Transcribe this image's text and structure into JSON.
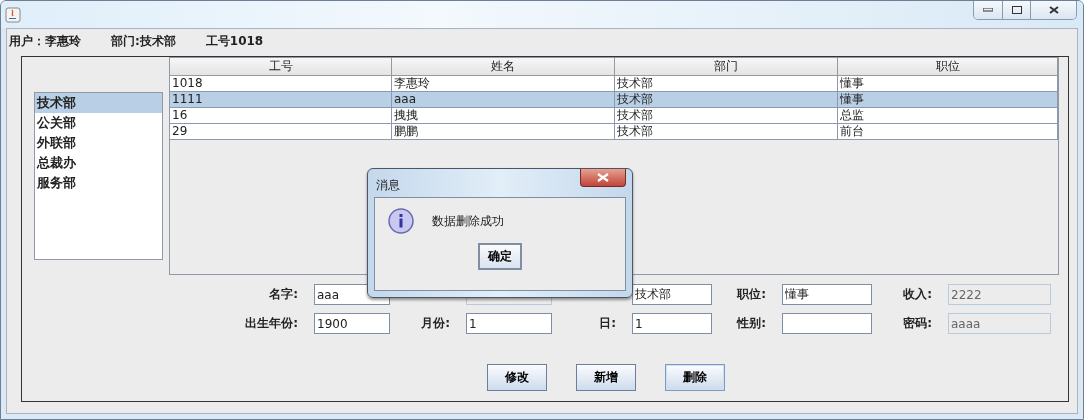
{
  "user_bar": [
    "用户：李惠玲",
    "部门:技术部",
    "工号1018"
  ],
  "departments": [
    {
      "label": "技术部",
      "selected": true
    },
    {
      "label": "公关部",
      "selected": false
    },
    {
      "label": "外联部",
      "selected": false
    },
    {
      "label": "总裁办",
      "selected": false
    },
    {
      "label": "服务部",
      "selected": false
    }
  ],
  "table": {
    "columns": [
      "工号",
      "姓名",
      "部门",
      "职位"
    ],
    "rows": [
      {
        "cells": [
          "1018",
          "李惠玲",
          "技术部",
          "懂事"
        ],
        "selected": false
      },
      {
        "cells": [
          "1111",
          "aaa",
          "技术部",
          "懂事"
        ],
        "selected": true
      },
      {
        "cells": [
          "16",
          "拽拽",
          "技术部",
          "总监"
        ],
        "selected": false
      },
      {
        "cells": [
          "29",
          "鹏鹏",
          "技术部",
          "前台"
        ],
        "selected": false
      }
    ]
  },
  "form": [
    [
      {
        "label": "名字:",
        "value": "aaa",
        "disabled": false
      },
      {
        "disabled": true
      },
      {
        "value": "技术部",
        "disabled": false
      },
      {
        "label": "职位:",
        "value": "懂事",
        "disabled": false
      },
      {
        "label": "收入:",
        "value": "2222",
        "disabled": true
      }
    ],
    [
      {
        "label": "出生年份:",
        "value": "1900",
        "disabled": false
      },
      {
        "label": "月份:",
        "value": "1",
        "disabled": false
      },
      {
        "label": "日:",
        "value": "1",
        "disabled": false
      },
      {
        "label": "性别:",
        "disabled": false
      },
      {
        "label": "密码:",
        "value": "aaaa",
        "disabled": true
      }
    ]
  ],
  "buttons": [
    {
      "label": "修改",
      "selected": false
    },
    {
      "label": "新增",
      "selected": false
    },
    {
      "label": "删除",
      "selected": true
    }
  ],
  "dialog": {
    "title": "消息",
    "message": "数据删除成功",
    "button": "确定"
  }
}
